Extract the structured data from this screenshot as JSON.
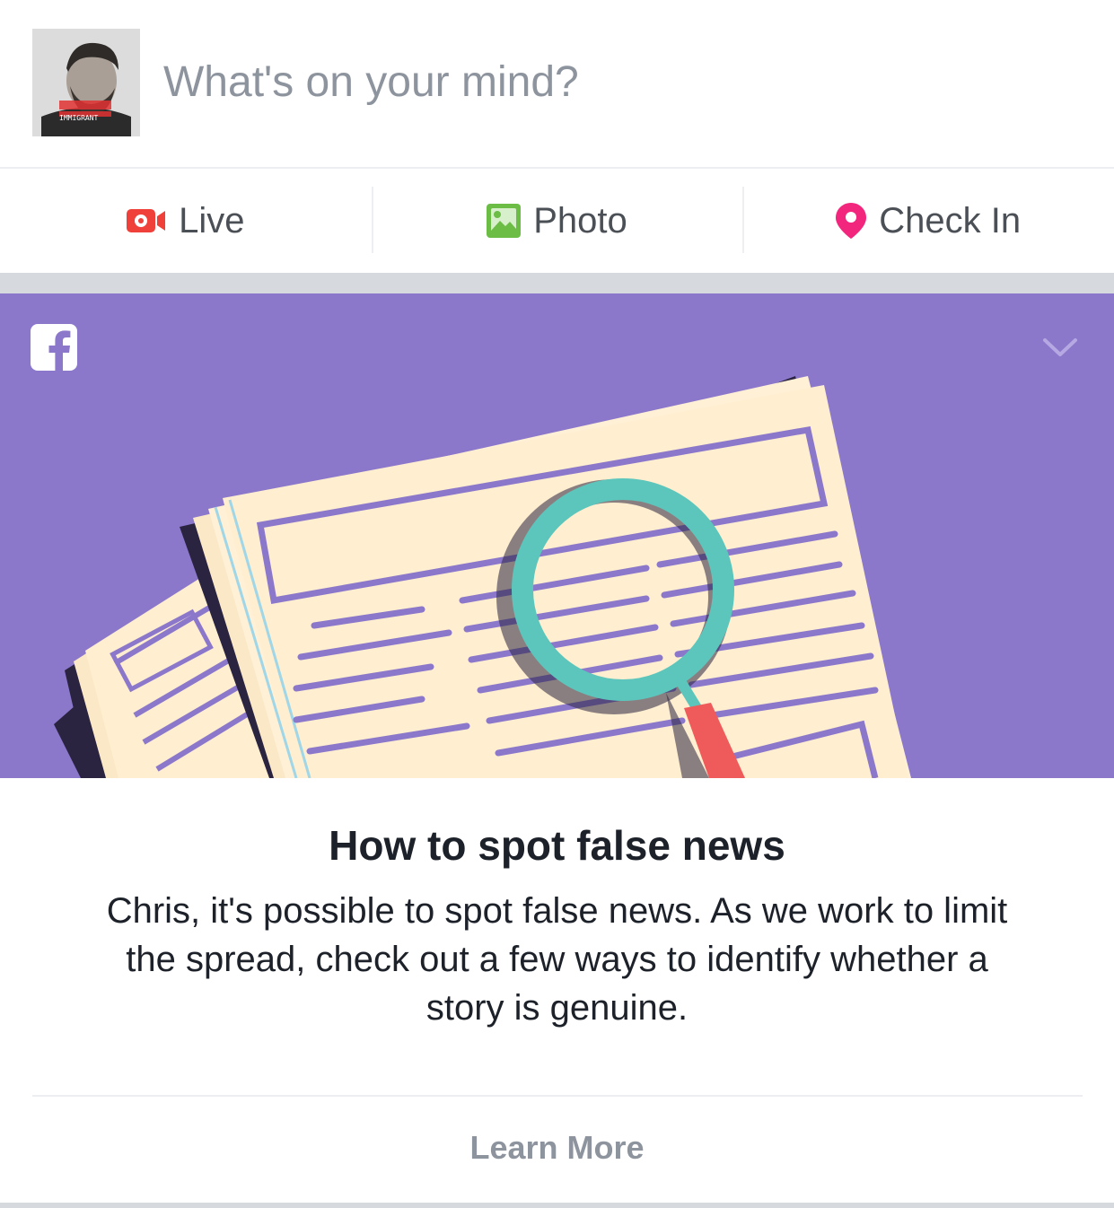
{
  "composer": {
    "placeholder": "What's on your mind?",
    "avatar_badge_text": "IMMIGRANT"
  },
  "actions": {
    "live_label": "Live",
    "photo_label": "Photo",
    "checkin_label": "Check In"
  },
  "card": {
    "title": "How to spot false news",
    "body": "Chris, it's possible to spot false news. As we work to limit the spread, check out a few ways to identify whether a story is genuine.",
    "cta_label": "Learn More",
    "hero_background": "#8c78cb"
  },
  "colors": {
    "live_icon": "#f0403a",
    "photo_icon": "#6bbd45",
    "checkin_icon": "#f3267d",
    "muted_text": "#8d949e",
    "action_text": "#4b4f56"
  },
  "icons": {
    "live": "live-video-icon",
    "photo": "photo-icon",
    "checkin": "location-pin-icon",
    "brand": "facebook-logo-icon",
    "menu": "chevron-down-icon"
  }
}
